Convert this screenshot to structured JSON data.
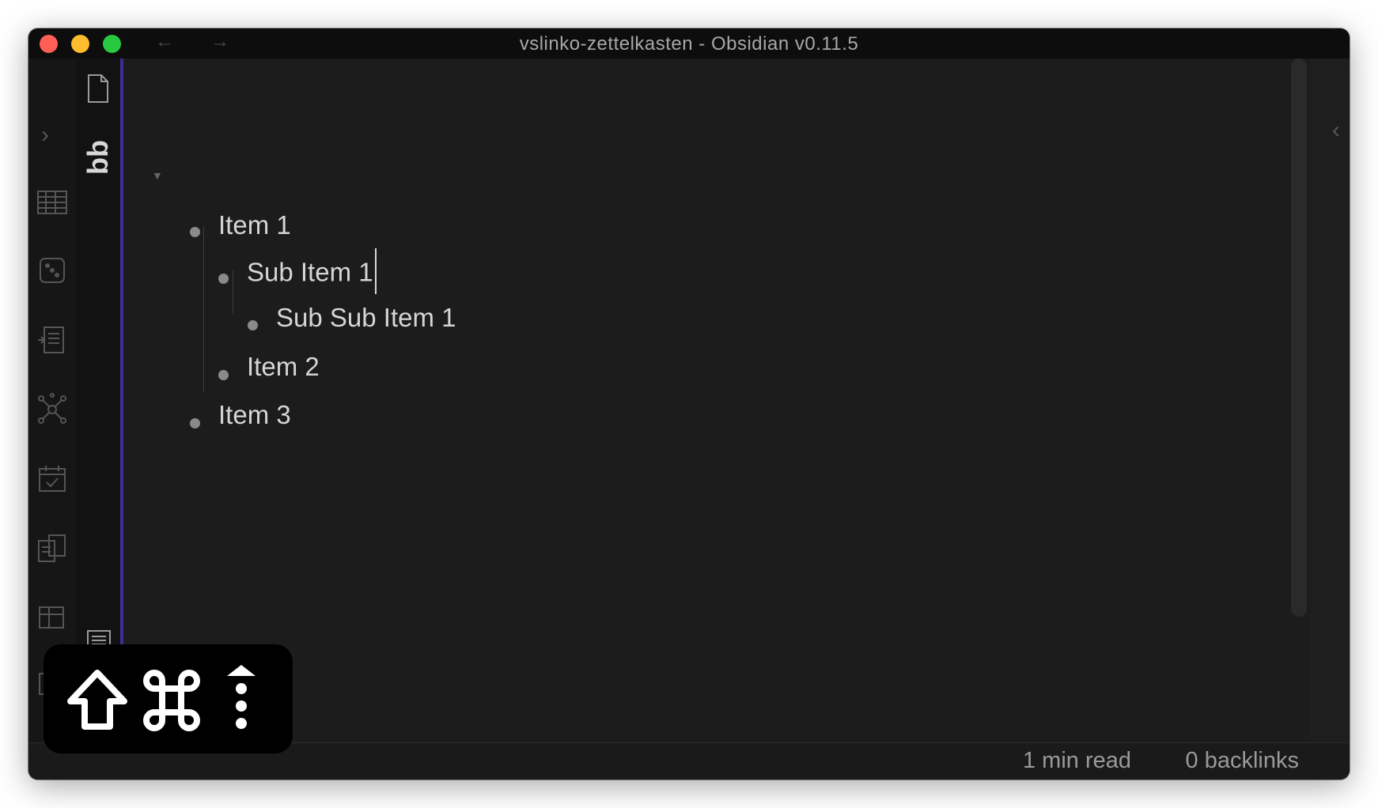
{
  "window": {
    "title": "vslinko-zettelkasten - Obsidian v0.11.5"
  },
  "titlebar": {
    "back_icon": "←",
    "forward_icon": "→"
  },
  "ribbon": {
    "expand_icon": "›",
    "icons": [
      "table-icon",
      "dice-icon",
      "import-icon",
      "graph-icon",
      "calendar-check-icon",
      "copy-documents-icon",
      "grid-icon",
      "layout-icon"
    ]
  },
  "file_pane": {
    "label": "bb"
  },
  "right_panel": {
    "expand_icon": "‹"
  },
  "editor": {
    "items": [
      {
        "text": "Item 1",
        "level": 0
      },
      {
        "text": "Sub Item 1",
        "level": 1
      },
      {
        "text": "Sub Sub Item 1",
        "level": 2
      },
      {
        "text": "Item 2",
        "level": 1
      },
      {
        "text": "Item 3",
        "level": 0
      }
    ],
    "fold_icon": "▼"
  },
  "status": {
    "read_time": "1 min read",
    "backlinks": "0 backlinks"
  },
  "keystroke_overlay": {
    "keys": [
      "shift-key-icon",
      "command-key-icon",
      "more-vertical-icon"
    ]
  }
}
